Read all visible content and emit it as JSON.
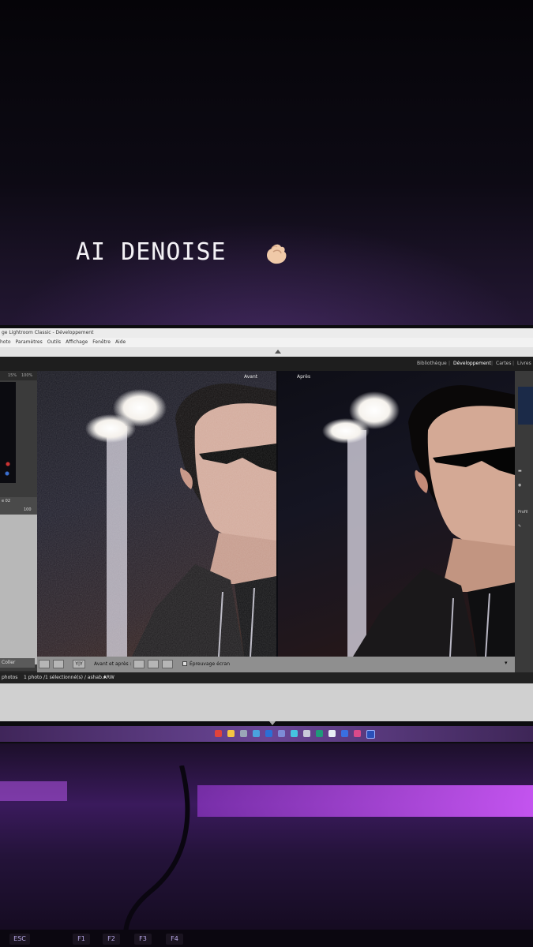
{
  "story": {
    "caption": "AI DENOISE"
  },
  "window": {
    "title": "ge Lightroom Classic - Développement",
    "menu": [
      "hoto",
      "Paramètres",
      "Outils",
      "Affichage",
      "Fenêtre",
      "Aide"
    ]
  },
  "modules": {
    "items": [
      "Bibliothèque",
      "Développement",
      "Cartes",
      "Livres"
    ],
    "active": "Développement"
  },
  "navigator": {
    "zoom_a": "15%",
    "zoom_b": "100%"
  },
  "left_panel": {
    "preset_label": "e 02",
    "preset_value": "100",
    "paste_button": "Coller"
  },
  "compare": {
    "before_label": "Avant",
    "after_label": "Après"
  },
  "toolbar": {
    "view_mode": "Y|Y",
    "before_after_label": "Avant et après :",
    "softproof_label": "Épreuvage écran"
  },
  "right_panel": {
    "profile_label": "Profil"
  },
  "filmstrip": {
    "photos_label": "photos",
    "selection_text": "1 photo /1 sélectionné(s) / ashab.ARW"
  },
  "keyboard": {
    "keys": [
      "ESC",
      "F1",
      "F2",
      "F3",
      "F4"
    ]
  },
  "colors": {
    "desk_glow": "#b04ce0",
    "taskbar": "#6a4696"
  }
}
